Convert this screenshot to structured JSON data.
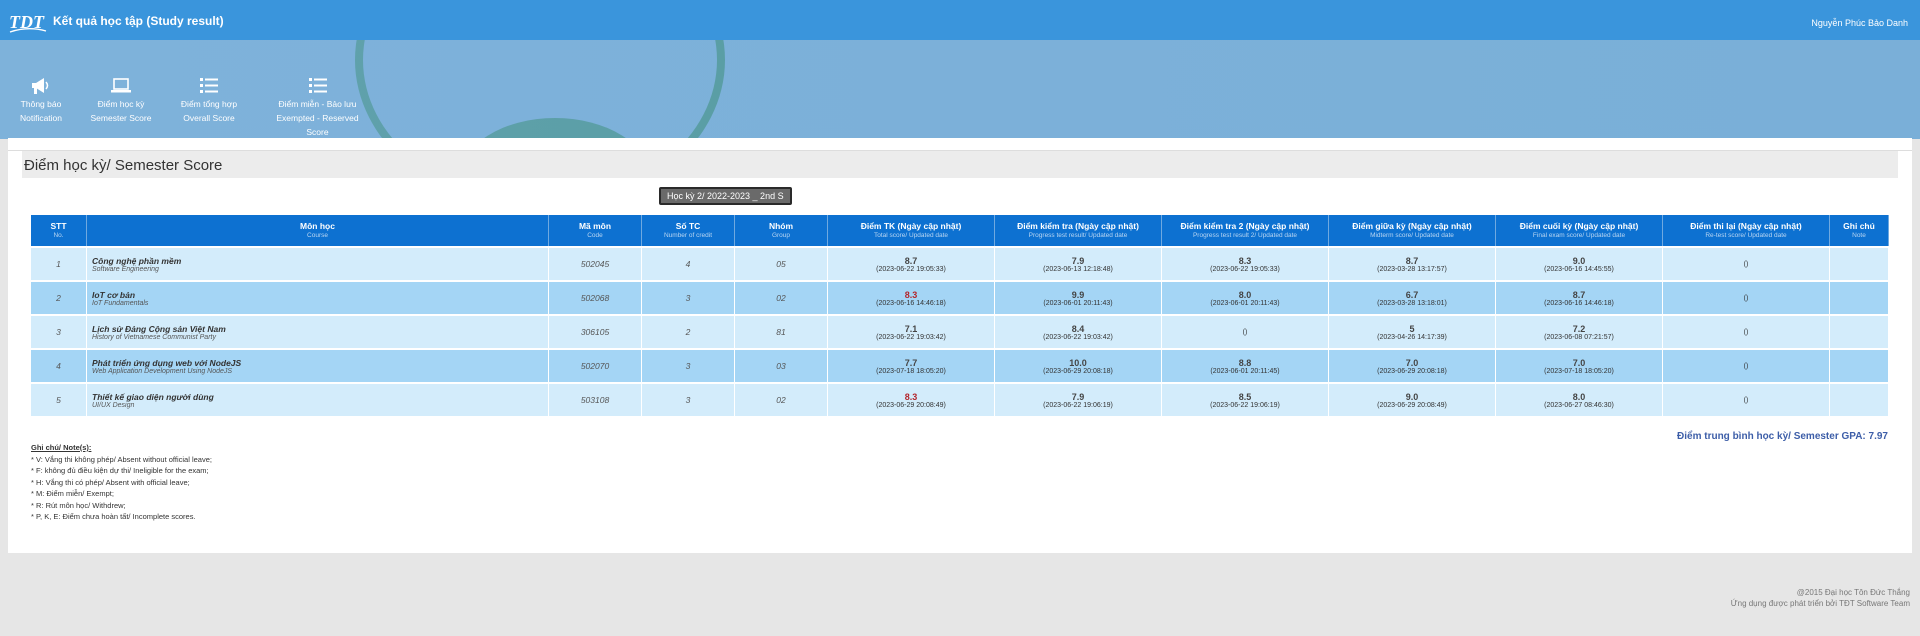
{
  "header": {
    "title": "Kết quả học tập (Study result)",
    "user_name": "Nguyễn Phúc Bảo Danh",
    "logo_text": "TDT"
  },
  "nav": [
    {
      "line1": "Thông báo",
      "line2": "Notification",
      "icon": "megaphone-icon"
    },
    {
      "line1": "Điểm học kỳ",
      "line2": "Semester Score",
      "icon": "laptop-icon"
    },
    {
      "line1": "Điểm tổng hợp",
      "line2": "Overall Score",
      "icon": "list-icon"
    },
    {
      "line1": "Điểm miễn - Bảo lưu",
      "line2": "Exempted - Reserved Score",
      "icon": "list-icon"
    }
  ],
  "page_title": "Điểm học kỳ/ Semester Score",
  "semester_select": "Học kỳ 2/ 2022-2023 _ 2nd S",
  "table": {
    "headers": [
      {
        "vi": "STT",
        "en": "No."
      },
      {
        "vi": "Môn học",
        "en": "Course"
      },
      {
        "vi": "Mã môn",
        "en": "Code"
      },
      {
        "vi": "Số TC",
        "en": "Number of credit"
      },
      {
        "vi": "Nhóm",
        "en": "Group"
      },
      {
        "vi": "Điểm TK (Ngày cập nhật)",
        "en": "Total score/ Updated date"
      },
      {
        "vi": "Điểm kiểm tra (Ngày cập nhật)",
        "en": "Progress test result/ Updated date"
      },
      {
        "vi": "Điểm kiểm tra 2 (Ngày cập nhật)",
        "en": "Progress test result 2/ Updated date"
      },
      {
        "vi": "Điểm giữa kỳ (Ngày cập nhật)",
        "en": "Midterm score/ Updated date"
      },
      {
        "vi": "Điểm cuối kỳ (Ngày cập nhật)",
        "en": "Final exam score/ Updated date"
      },
      {
        "vi": "Điểm thi lại (Ngày cập nhật)",
        "en": "Re-test score/ Updated date"
      },
      {
        "vi": "Ghi chú",
        "en": "Note"
      }
    ],
    "rows": [
      {
        "no": "1",
        "name": "Công nghệ phần mềm",
        "name_en": "Software Engineering",
        "code": "502045",
        "credit": "4",
        "group": "05",
        "total": {
          "s": "8.7",
          "d": "(2023-06-22 19:05:33)"
        },
        "p1": {
          "s": "7.9",
          "d": "(2023-06-13 12:18:48)"
        },
        "p2": {
          "s": "8.3",
          "d": "(2023-06-22 19:05:33)"
        },
        "mid": {
          "s": "8.7",
          "d": "(2023-03-28 13:17:57)"
        },
        "final": {
          "s": "9.0",
          "d": "(2023-06-16 14:45:55)"
        },
        "retest": {
          "s": "",
          "d": "()"
        },
        "note": ""
      },
      {
        "no": "2",
        "name": "IoT cơ bản",
        "name_en": "IoT Fundamentals",
        "code": "502068",
        "credit": "3",
        "group": "02",
        "total": {
          "s": "8.3",
          "d": "(2023-06-16 14:46:18)"
        },
        "p1": {
          "s": "9.9",
          "d": "(2023-06-01 20:11:43)"
        },
        "p2": {
          "s": "8.0",
          "d": "(2023-06-01 20:11:43)"
        },
        "mid": {
          "s": "6.7",
          "d": "(2023-03-28 13:18:01)"
        },
        "final": {
          "s": "8.7",
          "d": "(2023-06-16 14:46:18)"
        },
        "retest": {
          "s": "",
          "d": "()"
        },
        "note": ""
      },
      {
        "no": "3",
        "name": "Lịch sử Đảng Cộng sản Việt Nam",
        "name_en": "History of Vietnamese Communist Party",
        "code": "306105",
        "credit": "2",
        "group": "81",
        "total": {
          "s": "7.1",
          "d": "(2023-06-22 19:03:42)"
        },
        "p1": {
          "s": "8.4",
          "d": "(2023-06-22 19:03:42)"
        },
        "p2": {
          "s": "",
          "d": "()"
        },
        "mid": {
          "s": "5",
          "d": "(2023-04-26 14:17:39)"
        },
        "final": {
          "s": "7.2",
          "d": "(2023-06-08 07:21:57)"
        },
        "retest": {
          "s": "",
          "d": "()"
        },
        "note": ""
      },
      {
        "no": "4",
        "name": "Phát triển ứng dụng web với NodeJS",
        "name_en": "Web Application Development Using NodeJS",
        "code": "502070",
        "credit": "3",
        "group": "03",
        "total": {
          "s": "7.7",
          "d": "(2023-07-18 18:05:20)"
        },
        "p1": {
          "s": "10.0",
          "d": "(2023-06-29 20:08:18)"
        },
        "p2": {
          "s": "8.8",
          "d": "(2023-06-01 20:11:45)"
        },
        "mid": {
          "s": "7.0",
          "d": "(2023-06-29 20:08:18)"
        },
        "final": {
          "s": "7.0",
          "d": "(2023-07-18 18:05:20)"
        },
        "retest": {
          "s": "",
          "d": "()"
        },
        "note": ""
      },
      {
        "no": "5",
        "name": "Thiết kế giao diện người dùng",
        "name_en": "UI/UX Design",
        "code": "503108",
        "credit": "3",
        "group": "02",
        "total": {
          "s": "8.3",
          "d": "(2023-06-29 20:08:49)"
        },
        "p1": {
          "s": "7.9",
          "d": "(2023-06-22 19:06:19)"
        },
        "p2": {
          "s": "8.5",
          "d": "(2023-06-22 19:06:19)"
        },
        "mid": {
          "s": "9.0",
          "d": "(2023-06-29 20:08:49)"
        },
        "final": {
          "s": "8.0",
          "d": "(2023-06-27 08:46:30)"
        },
        "retest": {
          "s": "",
          "d": "()"
        },
        "note": ""
      }
    ]
  },
  "red_scores": [
    "8.3"
  ],
  "gpa": "Điểm trung bình học kỳ/ Semester GPA: 7.97",
  "notes": {
    "title": "Ghi chú/ Note(s):",
    "items": [
      "* V: Vắng thi không phép/ Absent without official leave;",
      "* F: không đủ điều kiện dự thi/ Ineligible for the exam;",
      "* H: Vắng thi có phép/ Absent with official leave;",
      "* M: Điểm miễn/ Exempt;",
      "* R: Rút môn học/ Withdrew;",
      "* P, K, E: Điểm chưa hoàn tất/ Incomplete scores."
    ]
  },
  "footer": {
    "line1": "@2015 Đại học Tôn Đức Thắng",
    "line2": "Ứng dụng được phát triển bởi TĐT Software Team"
  }
}
